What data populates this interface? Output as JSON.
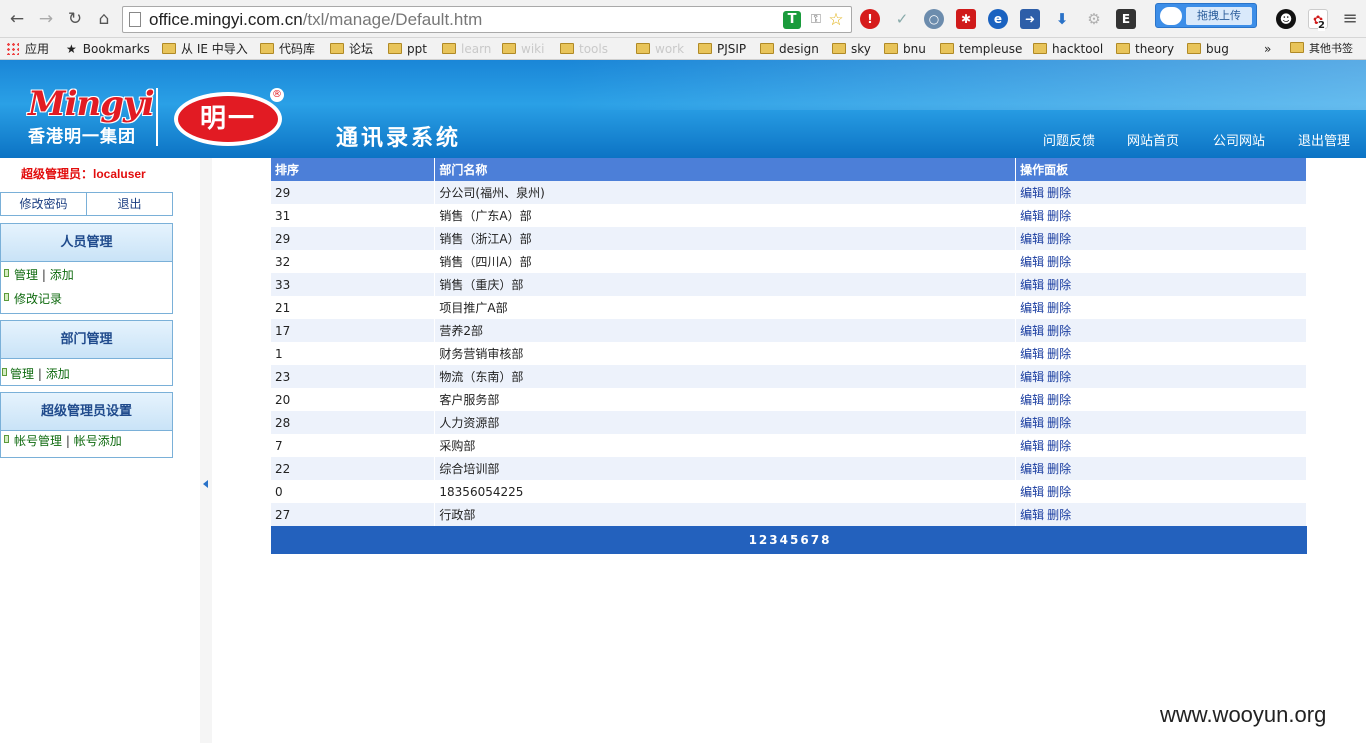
{
  "browser": {
    "url_main": "office.mingyi.com.cn",
    "url_path": "/txl/manage/Default.htm",
    "upload_label": "拖拽上传",
    "apps_label": "应用",
    "bookmarks": [
      {
        "label": "Bookmarks"
      },
      {
        "label": "从 IE 中导入"
      },
      {
        "label": "代码库"
      },
      {
        "label": "论坛"
      },
      {
        "label": "ppt"
      },
      {
        "label": "learn"
      },
      {
        "label": "wiki"
      },
      {
        "label": "tools"
      },
      {
        "label": "work"
      },
      {
        "label": "PJSIP"
      },
      {
        "label": "design"
      },
      {
        "label": "sky"
      },
      {
        "label": "bnu"
      },
      {
        "label": "templeuse"
      },
      {
        "label": "hacktool"
      },
      {
        "label": "theory"
      },
      {
        "label": "bug"
      }
    ],
    "overflow": "»",
    "other_bookmarks": "其他书签",
    "badge_count": "2"
  },
  "site": {
    "logo_word": "Mingyi",
    "logo_sub": "香港明一集团",
    "badge_text": "明一",
    "title": "通讯录系统",
    "nav": [
      "问题反馈",
      "网站首页",
      "公司网站",
      "退出管理"
    ]
  },
  "sidebar": {
    "admin_label": "超级管理员：",
    "admin_user": "localuser",
    "change_password": "修改密码",
    "logout": "退出",
    "panels": [
      {
        "title": "人员管理",
        "rows": [
          {
            "a": "管理",
            "sep": " | ",
            "b": "添加"
          },
          {
            "a": "修改记录",
            "sep": "",
            "b": ""
          }
        ]
      },
      {
        "title": "部门管理",
        "rows": [
          {
            "a": "管理",
            "sep": " | ",
            "b": "添加"
          }
        ]
      },
      {
        "title": "超级管理员设置",
        "rows": [
          {
            "a": "帐号管理",
            "sep": " | ",
            "b": "帐号添加"
          }
        ]
      }
    ]
  },
  "table": {
    "headers": [
      "排序",
      "部门名称",
      "操作面板"
    ],
    "edit_label": "编辑",
    "delete_label": "删除",
    "rows": [
      {
        "order": "29",
        "name": "分公司(福州、泉州)"
      },
      {
        "order": "31",
        "name": "销售（广东A）部"
      },
      {
        "order": "29",
        "name": "销售（浙江A）部"
      },
      {
        "order": "32",
        "name": "销售（四川A）部"
      },
      {
        "order": "33",
        "name": "销售（重庆）部"
      },
      {
        "order": "21",
        "name": "项目推广A部"
      },
      {
        "order": "17",
        "name": "营养2部"
      },
      {
        "order": "1",
        "name": "财务营销审核部"
      },
      {
        "order": "23",
        "name": "物流（东南）部"
      },
      {
        "order": "20",
        "name": "客户服务部"
      },
      {
        "order": "28",
        "name": "人力资源部"
      },
      {
        "order": "7",
        "name": "采购部"
      },
      {
        "order": "22",
        "name": "综合培训部"
      },
      {
        "order": "0",
        "name": "18356054225"
      },
      {
        "order": "27",
        "name": "行政部"
      }
    ],
    "pages": [
      "1",
      "2",
      "3",
      "4",
      "5",
      "6",
      "7",
      "8"
    ]
  },
  "watermark": "www.wooyun.org"
}
